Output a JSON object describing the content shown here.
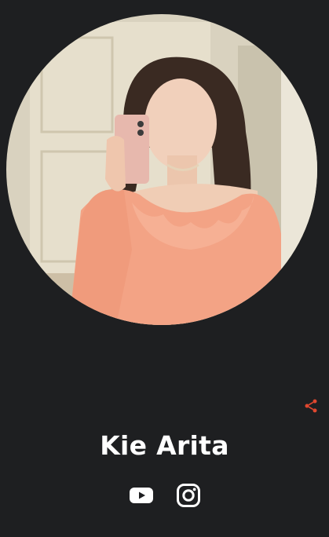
{
  "profile": {
    "name": "Kie Arita"
  },
  "icons": {
    "avatar": "profile-photo",
    "share": "share-icon",
    "youtube": "youtube-icon",
    "instagram": "instagram-icon"
  },
  "colors": {
    "background": "#1e1f21",
    "share_accent": "#e0472f",
    "name_text": "#ffffff",
    "social_icons": "#ffffff"
  }
}
